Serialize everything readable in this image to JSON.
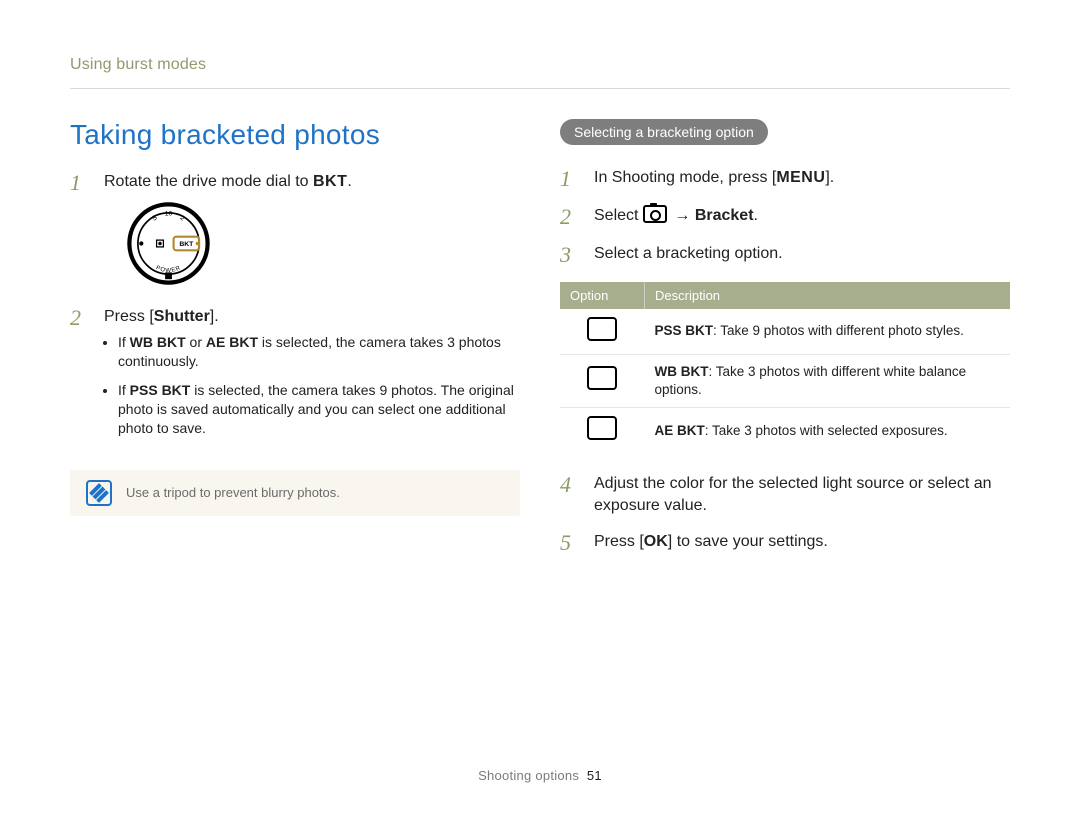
{
  "chrome": {
    "running_head": "Using burst modes"
  },
  "title": "Taking bracketed photos",
  "left": {
    "step1": {
      "pre": "Rotate the drive mode dial to ",
      "bkt": "BKT",
      "post": "."
    },
    "step2": {
      "text_pre": "Press [",
      "shutter": "Shutter",
      "text_post": "].",
      "bullets": [
        {
          "prefix": "If ",
          "b1": "WB BKT",
          "mid": " or ",
          "b2": "AE BKT",
          "rest": " is selected, the camera takes 3 photos continuously."
        },
        {
          "prefix": "If ",
          "b1": "PSS BKT",
          "rest": " is selected, the camera takes 9 photos. The original photo is saved automatically and you can select one additional photo to save."
        }
      ]
    },
    "note": "Use a tripod to prevent blurry photos."
  },
  "right": {
    "pill": "Selecting a bracketing option",
    "step1": {
      "pre": "In Shooting mode, press [",
      "menu": "MENU",
      "post": "]."
    },
    "step2": {
      "pre": "Select ",
      "arrow": "→",
      "bracket": "Bracket",
      "post": "."
    },
    "step3": "Select a bracketing option.",
    "table": {
      "headers": [
        "Option",
        "Description"
      ],
      "rows": [
        {
          "b": "PSS BKT",
          "rest": ": Take 9 photos with different photo styles."
        },
        {
          "b": "WB BKT",
          "rest": ": Take 3 photos with different white balance options."
        },
        {
          "b": "AE BKT",
          "rest": ": Take 3 photos with selected exposures."
        }
      ]
    },
    "step4": "Adjust the color for the selected light source or select an exposure value.",
    "step5": {
      "pre": "Press [",
      "ok": "OK",
      "post": "] to save your settings."
    }
  },
  "footer": {
    "section": "Shooting options",
    "page": "51"
  }
}
